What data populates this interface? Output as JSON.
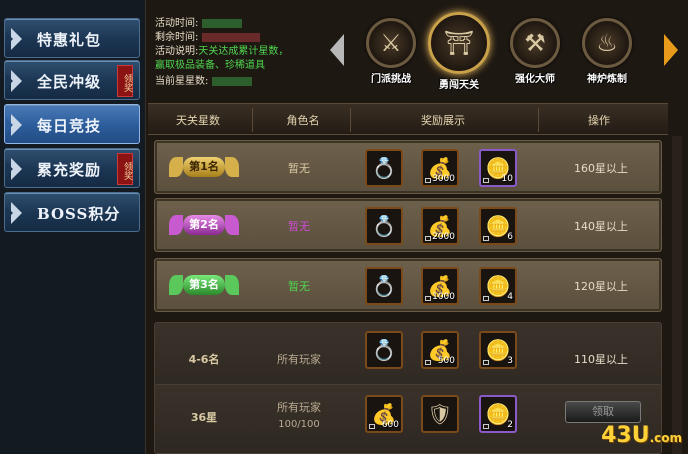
{
  "sidebar": {
    "items": [
      {
        "label": "特惠礼包",
        "badge": ""
      },
      {
        "label": "全民冲级",
        "badge": "领奖"
      },
      {
        "label": "每日竞技",
        "badge": ""
      },
      {
        "label": "累充奖励",
        "badge": "领奖"
      },
      {
        "label": "BOSS积分",
        "badge": ""
      }
    ],
    "active_index": 2
  },
  "activity": {
    "time_label": "活动时间:",
    "remaining_label": "剩余时间:",
    "desc_label": "活动说明:",
    "desc_line1": "天关达成累计星数，",
    "desc_line2": "赢取极品装备、珍稀道具",
    "stars_label": "当前星星数:"
  },
  "modes": [
    {
      "label": "门派挑战",
      "icon": "crossed-swords-icon"
    },
    {
      "label": "勇闯天关",
      "icon": "gate-tower-icon"
    },
    {
      "label": "强化大师",
      "icon": "anvil-icon"
    },
    {
      "label": "神炉炼制",
      "icon": "furnace-icon"
    }
  ],
  "active_mode_index": 1,
  "table": {
    "headers": [
      "天关星数",
      "角色名",
      "奖励展示",
      "操作"
    ]
  },
  "rows": [
    {
      "rank": "第1名",
      "name": "暂无",
      "name_color": "#e6dcc6",
      "requirement": "160星以上",
      "rewards": [
        {
          "icon": "ring-icon",
          "count": ""
        },
        {
          "icon": "gold-ingot-icon",
          "count": "3000"
        },
        {
          "icon": "gold-bar-icon",
          "count": "10"
        }
      ]
    },
    {
      "rank": "第2名",
      "name": "暂无",
      "name_color": "#d04ad6",
      "requirement": "140星以上",
      "rewards": [
        {
          "icon": "ring-icon",
          "count": ""
        },
        {
          "icon": "gold-ingot-icon",
          "count": "2000"
        },
        {
          "icon": "gold-bar-icon",
          "count": "6"
        }
      ]
    },
    {
      "rank": "第3名",
      "name": "暂无",
      "name_color": "#4fd64f",
      "requirement": "120星以上",
      "rewards": [
        {
          "icon": "ring-icon",
          "count": ""
        },
        {
          "icon": "gold-ingot-icon",
          "count": "1000"
        },
        {
          "icon": "gold-bar-icon",
          "count": "4"
        }
      ]
    },
    {
      "rank": "4-6名",
      "name": "所有玩家",
      "name_color": "#b8ab90",
      "requirement": "110星以上",
      "rewards": [
        {
          "icon": "ring-icon",
          "count": ""
        },
        {
          "icon": "gold-ingot-icon",
          "count": "500"
        },
        {
          "icon": "gold-bar-icon",
          "count": "3"
        }
      ]
    },
    {
      "rank": "36星",
      "name": "所有玩家",
      "name_sub": "100/100",
      "name_color": "#b8ab90",
      "button": "领取",
      "rewards": [
        {
          "icon": "gold-ingot-icon",
          "count": "600"
        },
        {
          "icon": "gem-shield-icon",
          "count": ""
        },
        {
          "icon": "gold-bar-icon",
          "count": "2"
        }
      ]
    }
  ],
  "watermark": {
    "main": "43U",
    "suffix": ".com"
  }
}
